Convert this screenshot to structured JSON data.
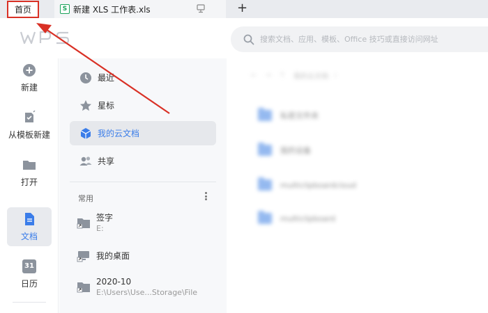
{
  "tabs": {
    "home_label": "首页",
    "file_label": "新建 XLS 工作表.xls",
    "file_icon_letter": "S",
    "file_icon": "spreadsheet-icon",
    "add_label": "+"
  },
  "header": {
    "logo_text": "WPS",
    "search_placeholder": "搜索文档、应用、模板、Office 技巧或直接访问网址"
  },
  "rail": {
    "items": [
      {
        "label": "新建",
        "icon": "plus-circle-icon"
      },
      {
        "label": "从模板新建",
        "icon": "template-icon"
      },
      {
        "label": "打开",
        "icon": "folder-icon"
      },
      {
        "label": "文档",
        "icon": "document-icon"
      },
      {
        "label": "日历",
        "icon": "calendar-icon",
        "icon_text": "31"
      }
    ]
  },
  "nav": {
    "items": [
      {
        "label": "最近",
        "icon": "clock-icon"
      },
      {
        "label": "星标",
        "icon": "star-icon"
      },
      {
        "label": "我的云文档",
        "icon": "cloud-cube-icon"
      },
      {
        "label": "共享",
        "icon": "people-icon"
      }
    ],
    "section_label": "常用",
    "favorites": [
      {
        "name": "签字",
        "path": "E:"
      },
      {
        "name": "我的桌面",
        "path": ""
      },
      {
        "name": "2020-10",
        "path": "E:\\Users\\Use...Storage\\File"
      }
    ]
  },
  "main": {
    "breadcrumb": "我的云文档",
    "rows": [
      "私密文件夹",
      "我的设备",
      "multiclipboardcloud",
      "multiclipboard"
    ]
  },
  "colors": {
    "annotation": "#d93025",
    "accent": "#3b7de9"
  }
}
